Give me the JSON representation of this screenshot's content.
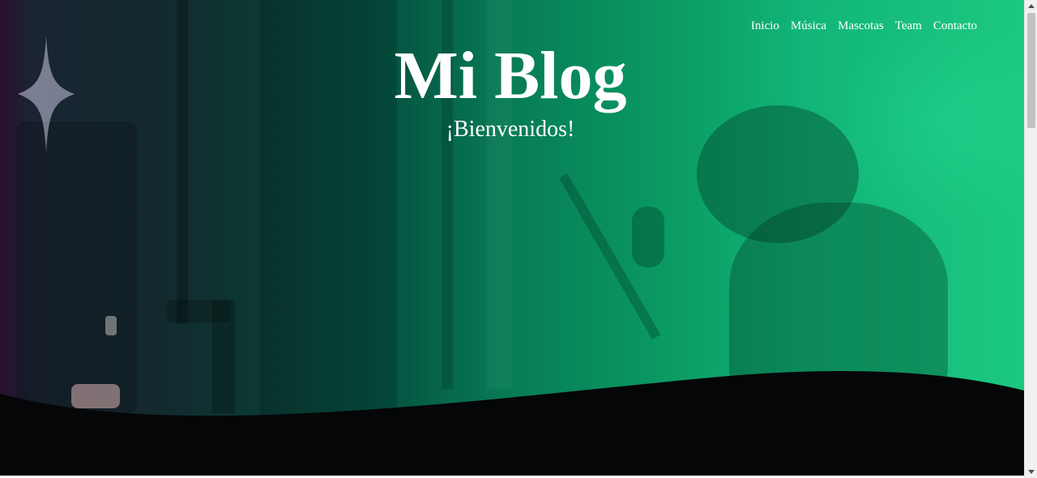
{
  "nav": {
    "items": [
      {
        "label": "Inicio"
      },
      {
        "label": "Música"
      },
      {
        "label": "Mascotas"
      },
      {
        "label": "Team"
      },
      {
        "label": "Contacto"
      }
    ]
  },
  "header": {
    "title": "Mi Blog",
    "subtitle": "¡Bienvenidos!"
  },
  "theme": {
    "accent_green": "#1cc880",
    "dark_teal": "#054b3d",
    "wave_color": "#050608",
    "text_color": "#ffffff"
  },
  "icons": {
    "sparkle": "sparkle-icon"
  }
}
